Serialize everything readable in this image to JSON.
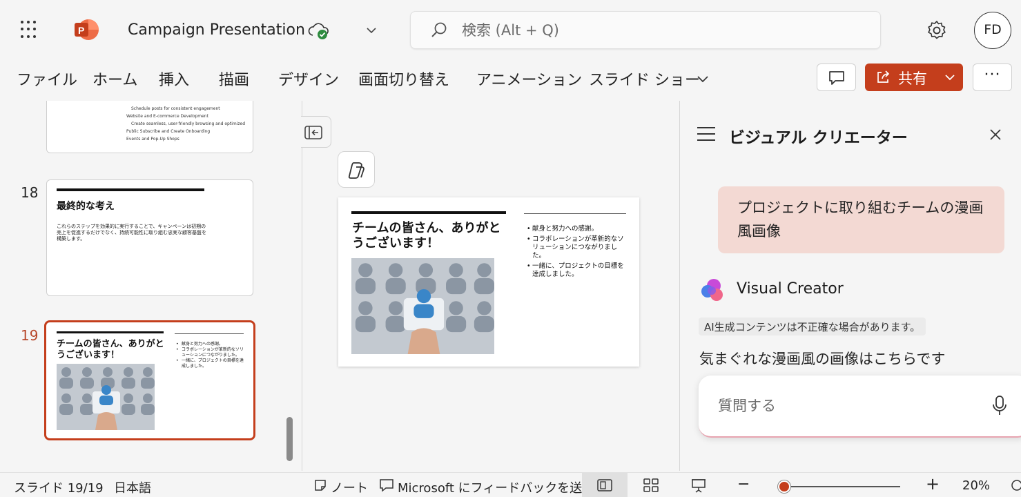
{
  "app": {
    "document_title": "Campaign Presentation",
    "user_initials": "FD",
    "colors": {
      "accent": "#c43e1c",
      "bubble": "#f3d9d3",
      "sync_ok": "#2e8b3f"
    }
  },
  "search": {
    "placeholder": "検索 (Alt + Q)"
  },
  "ribbon": {
    "tabs": [
      "ファイル",
      "ホーム",
      "挿入",
      "描画",
      "デザイン",
      "画面切り替え",
      "アニメーション",
      "スライド ショー"
    ],
    "share_label": "共有",
    "more_label": "···"
  },
  "thumbnails": {
    "slide17": {
      "lines": [
        "Schedule posts for consistent engagement",
        "Website and E-commerce Development",
        "Create seamless, user-friendly browsing and optimized",
        "Public Subscribe and Create Onboarding",
        "Events and Pop-Up Shops"
      ]
    },
    "slide18": {
      "number": "18",
      "title": "最終的な考え",
      "body": "これらのステップを効果的に実行することで、キャンペーンは初期の売上を促進するだけでなく、持続可能性に取り組む忠実な顧客基盤を構築します。"
    },
    "slide19": {
      "number": "19"
    }
  },
  "slide19": {
    "title": "チームの皆さん、ありがとうございます！",
    "bullets": [
      "献身と努力への感謝。",
      "コラボレーションが革新的なソリューションにつながりました。",
      "一緒に、プロジェクトの目標を達成しました。"
    ]
  },
  "right_pane": {
    "title": "ビジュアル クリエーター",
    "user_prompt": "プロジェクトに取り組むチームの漫画風画像",
    "assistant_name": "Visual Creator",
    "ai_disclaimer": "AI生成コンテンツは不正確な場合があります。",
    "reply": "気まぐれな漫画風の画像はこちらです",
    "ask_placeholder": "質問する"
  },
  "statusbar": {
    "slide_counter": "スライド 19/19",
    "language": "日本語",
    "notes_label": "ノート",
    "feedback_label": "Microsoft にフィードバックを送信",
    "zoom_out": "−",
    "zoom_in": "+",
    "zoom_percent": "20%",
    "zoom_level": 0.2
  }
}
